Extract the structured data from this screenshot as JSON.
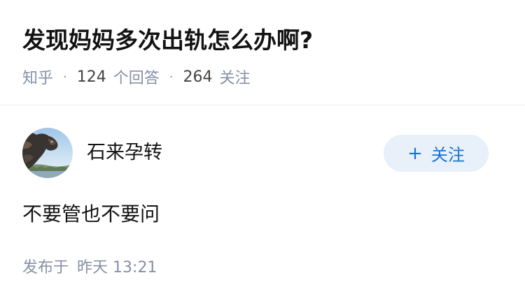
{
  "question": {
    "title": "发现妈妈多次出轨怎么办啊?",
    "source": "知乎",
    "answers_count": "124",
    "answers_label": "个回答",
    "followers_count": "264",
    "followers_label": "关注",
    "separator": "·"
  },
  "answer": {
    "author": {
      "name": "石来孕转",
      "avatar_icon": "avatar-dragon-statue"
    },
    "follow_button": {
      "plus": "+",
      "label": "关注"
    },
    "content": "不要管也不要问",
    "published_label": "发布于",
    "published_day": "昨天",
    "published_time": "13:21"
  },
  "colors": {
    "accent": "#1772d0",
    "button_bg": "#e8f0fa",
    "meta_text": "#8590a6",
    "primary_text": "#121212",
    "divider": "#eeeeee"
  }
}
